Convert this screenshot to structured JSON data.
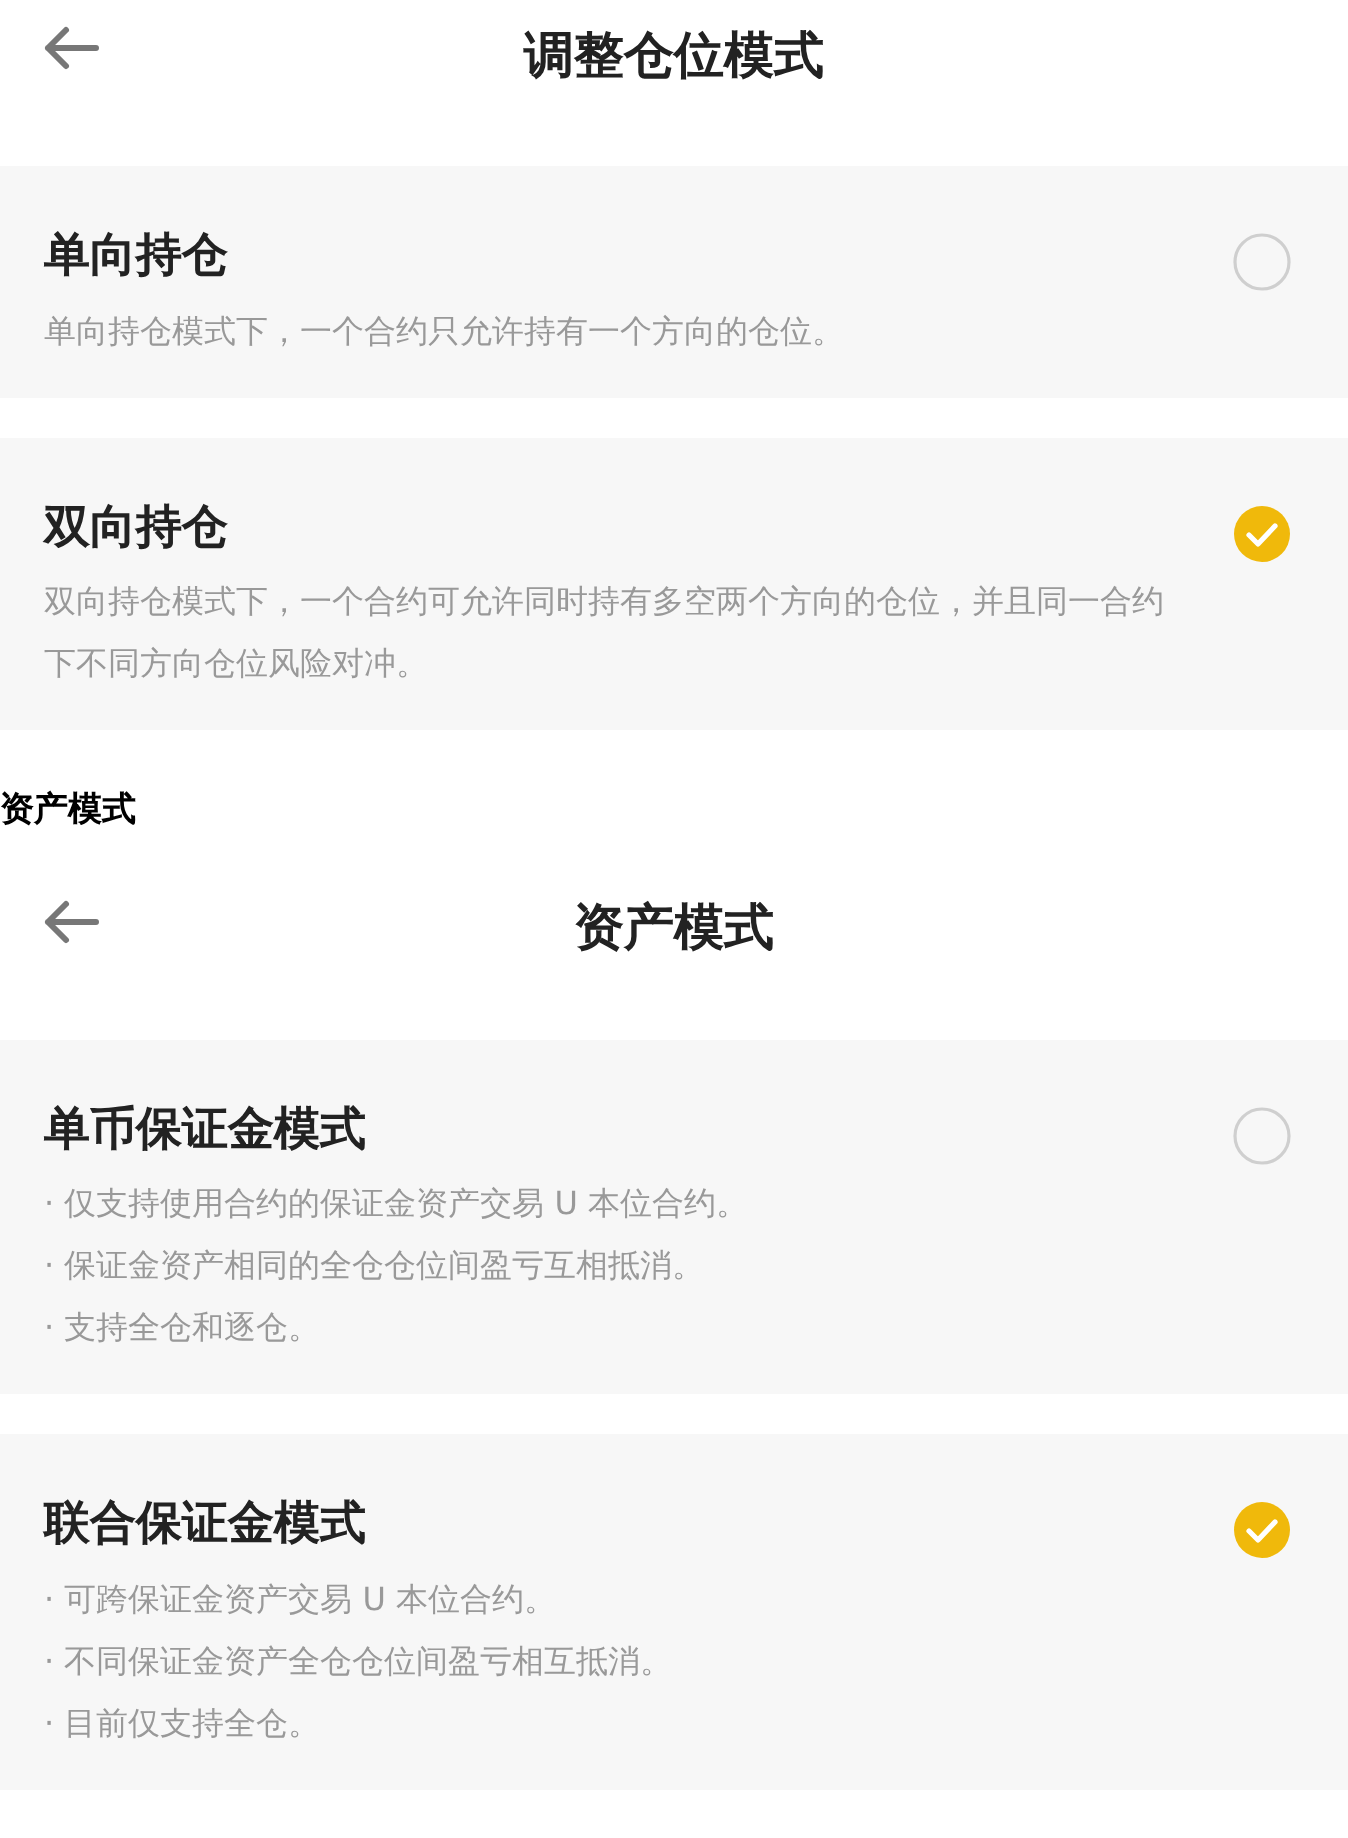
{
  "blocks": [
    {
      "kind": "screen",
      "header": {
        "title": "调整仓位模式"
      },
      "options": [
        {
          "title": "单向持仓",
          "lines": [
            "单向持仓模式下，一个合约只允许持有一个方向的仓位。"
          ],
          "selected": false
        },
        {
          "title": "双向持仓",
          "lines": [
            "双向持仓模式下，一个合约可允许同时持有多空两个方向的仓位，并且同一合约下不同方向仓位风险对冲。"
          ],
          "selected": true
        }
      ]
    },
    {
      "kind": "label",
      "text": "资产模式"
    },
    {
      "kind": "screen",
      "header": {
        "title": "资产模式"
      },
      "options": [
        {
          "title": "单币保证金模式",
          "lines": [
            "· 仅支持使用合约的保证金资产交易 U 本位合约。",
            "· 保证金资产相同的全仓仓位间盈亏互相抵消。",
            "· 支持全仓和逐仓。"
          ],
          "selected": false
        },
        {
          "title": "联合保证金模式",
          "lines": [
            "· 可跨保证金资产交易 U 本位合约。",
            "· 不同保证金资产全仓仓位间盈亏相互抵消。",
            "· 目前仅支持全仓。"
          ],
          "selected": true
        }
      ]
    }
  ]
}
